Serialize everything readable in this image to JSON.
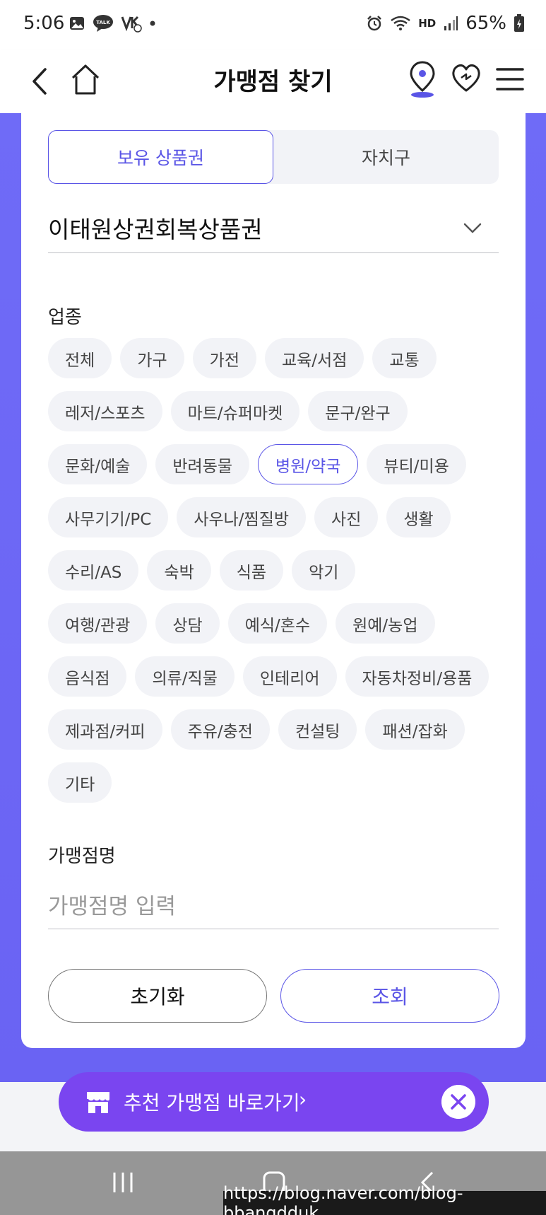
{
  "status_bar": {
    "time": "5:06",
    "left_icons": [
      "gallery-icon",
      "talk-icon",
      "vk-icon",
      "dot-icon"
    ],
    "right_icons": [
      "alarm-icon",
      "wifi-icon",
      "hd-voice-icon",
      "signal-icon",
      "battery-icon"
    ],
    "hd_label": "HD",
    "battery": "65%"
  },
  "header": {
    "title": "가맹점 찾기",
    "icons": [
      "back-icon",
      "home-icon",
      "location-pin-icon",
      "heart-icon",
      "menu-icon"
    ]
  },
  "tabs": [
    {
      "label": "보유 상품권",
      "active": true
    },
    {
      "label": "자치구",
      "active": false
    }
  ],
  "voucher_select": {
    "value": "이태원상권회복상품권"
  },
  "category": {
    "label": "업종",
    "rows": [
      [
        "전체",
        "가구",
        "가전",
        "교육/서점",
        "교통"
      ],
      [
        "레저/스포츠",
        "마트/슈퍼마켓",
        "문구/완구"
      ],
      [
        "문화/예술",
        "반려동물",
        "병원/약국",
        "뷰티/미용"
      ],
      [
        "사무기기/PC",
        "사우나/찜질방",
        "사진",
        "생활"
      ],
      [
        "수리/AS",
        "숙박",
        "식품",
        "악기"
      ],
      [
        "여행/관광",
        "상담",
        "예식/혼수",
        "원예/농업"
      ],
      [
        "음식점",
        "의류/직물",
        "인테리어",
        "자동차정비/용품"
      ],
      [
        "제과점/커피",
        "주유/충전",
        "컨설팅",
        "패션/잡화"
      ],
      [
        "기타"
      ]
    ],
    "selected": "병원/약국"
  },
  "store_name": {
    "label": "가맹점명",
    "placeholder": "가맹점명 입력"
  },
  "buttons": {
    "reset": "초기화",
    "search": "조회"
  },
  "banner": {
    "text": "추천 가맹점 바로가기",
    "arrow": "›"
  },
  "watermark": "https://blog.naver.com/blog-bbangdduk",
  "colors": {
    "accent": "#5a55e6",
    "purple_bg": "#6f6bf7",
    "banner": "#7a45f0",
    "chip_bg": "#f2f3f7"
  }
}
